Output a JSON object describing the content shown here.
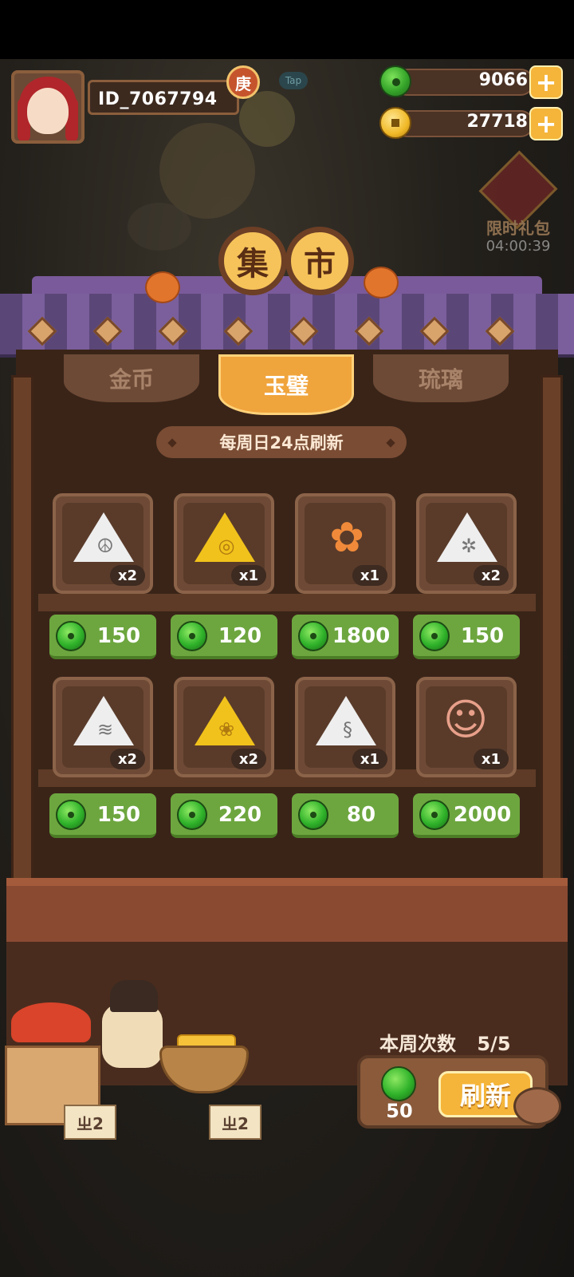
{
  "player": {
    "id": "ID_7067794",
    "rank_badge": "庚",
    "tap_hint": "Tap"
  },
  "currency": {
    "jade": "9066",
    "coins": "27718",
    "plus": "+"
  },
  "limited_gift": {
    "label": "限时礼包",
    "timer": "04:00:39"
  },
  "title": [
    "集",
    "市"
  ],
  "tabs": [
    {
      "label": "金币",
      "active": false
    },
    {
      "label": "玉璧",
      "active": true
    },
    {
      "label": "琉璃",
      "active": false
    }
  ],
  "refresh_note": "每周日24点刷新",
  "items": [
    {
      "icon": "leaf-jade-icon",
      "qty": "x2",
      "price": "150",
      "tri_color": "#eeeeee",
      "glyph": "☮"
    },
    {
      "icon": "swirl-gold-jade-icon",
      "qty": "x1",
      "price": "120",
      "tri_color": "#f1c21b",
      "glyph": "◎"
    },
    {
      "icon": "flower-wreath-icon",
      "qty": "x1",
      "price": "1800",
      "tri_color": "",
      "glyph": "✿"
    },
    {
      "icon": "beetle-jade-icon",
      "qty": "x2",
      "price": "150",
      "tri_color": "#eeeeee",
      "glyph": "✲"
    },
    {
      "icon": "wave-jade-icon",
      "qty": "x2",
      "price": "150",
      "tri_color": "#eeeeee",
      "glyph": "≋"
    },
    {
      "icon": "fish-gold-jade-icon",
      "qty": "x2",
      "price": "220",
      "tri_color": "#f1c21b",
      "glyph": "❀"
    },
    {
      "icon": "snake-jade-icon",
      "qty": "x1",
      "price": "80",
      "tri_color": "#eeeeee",
      "glyph": "§"
    },
    {
      "icon": "girl-portrait-icon",
      "qty": "x1",
      "price": "2000",
      "tri_color": "",
      "glyph": "☺"
    }
  ],
  "weekly_label": "本周次数",
  "weekly_count": "5/5",
  "refresh_cost": "50",
  "refresh_button": "刷新",
  "stall_signs": [
    "ㄓ2",
    "ㄓ2"
  ],
  "colors": {
    "jade": "#36a52a",
    "price_bg": "#6da63f",
    "tab_active": "#f0a43c",
    "button": "#f5b53a"
  }
}
